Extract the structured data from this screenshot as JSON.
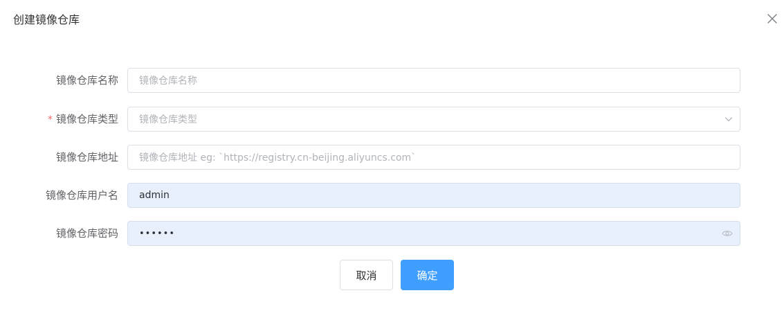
{
  "dialog": {
    "title": "创建镜像仓库"
  },
  "form": {
    "name": {
      "label": "镜像仓库名称",
      "placeholder": "镜像仓库名称",
      "value": ""
    },
    "type": {
      "required_mark": "*",
      "label": "镜像仓库类型",
      "placeholder": "镜像仓库类型",
      "value": ""
    },
    "address": {
      "label": "镜像仓库地址",
      "placeholder": "镜像仓库地址 eg: `https://registry.cn-beijing.aliyuncs.com`",
      "value": ""
    },
    "username": {
      "label": "镜像仓库用户名",
      "value": "admin"
    },
    "password": {
      "label": "镜像仓库密码",
      "value_masked": "••••••"
    }
  },
  "buttons": {
    "cancel_label": "取消",
    "confirm_label": "确定"
  },
  "icons": {
    "close": "close-icon",
    "type_dropdown": "chevron-down-icon",
    "password_toggle": "eye-icon"
  },
  "colors": {
    "primary": "#409eff",
    "required": "#f56c6c",
    "autofill_bg": "#e8f0fe"
  }
}
